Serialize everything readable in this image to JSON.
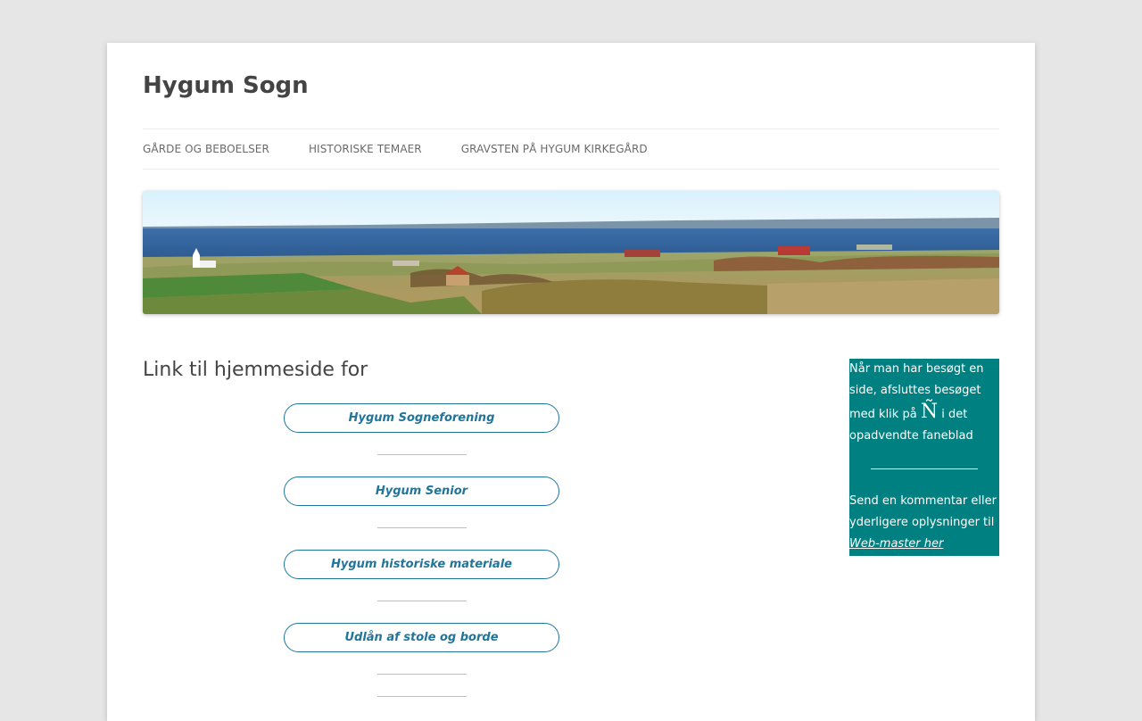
{
  "site": {
    "title": "Hygum Sogn"
  },
  "nav": {
    "items": [
      {
        "label": "GÅRDE OG BEBOELSER"
      },
      {
        "label": "HISTORISKE TEMAER"
      },
      {
        "label": "GRAVSTEN PÅ HYGUM KIRKEGÅRD"
      }
    ]
  },
  "content": {
    "title": "Link til hjemmeside for",
    "links": [
      {
        "label": "Hygum Sogneforening"
      },
      {
        "label": "Hygum Senior"
      },
      {
        "label": "Hygum historiske materiale"
      },
      {
        "label": "Udlån af stole og borde"
      }
    ]
  },
  "sidebar": {
    "text1": "Når man har besøgt en side, afsluttes besøget med klik på",
    "symbol": "Ñ",
    "text2": "i det opadvendte faneblad",
    "text3": "Send en kommentar eller yderligere oplysninger til",
    "link_label": "Web-master her",
    "bg_color": "#008080"
  },
  "colors": {
    "link": "#21759b",
    "background": "#e6e6e6"
  }
}
